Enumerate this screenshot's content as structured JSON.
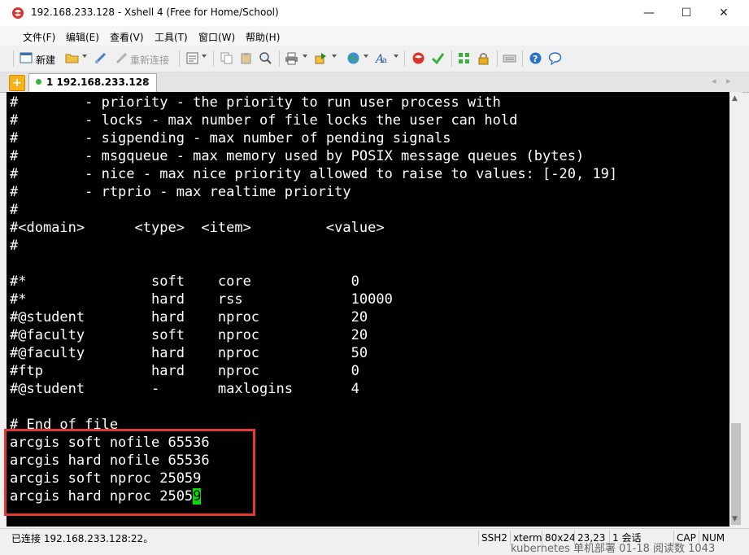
{
  "window": {
    "title": "192.168.233.128 - Xshell 4 (Free for Home/School)",
    "minimize": "—",
    "maximize": "☐",
    "close": "✕"
  },
  "menu": [
    "文件(F)",
    "编辑(E)",
    "查看(V)",
    "工具(T)",
    "窗口(W)",
    "帮助(H)"
  ],
  "toolbar": {
    "new_label": "新建",
    "reconnect_label": "重新连接"
  },
  "tab": {
    "plus": "+",
    "label": "1 192.168.233.128",
    "close": "×",
    "prev": "◂",
    "next": "▸"
  },
  "terminal": {
    "lines": [
      "#        - priority - the priority to run user process with",
      "#        - locks - max number of file locks the user can hold",
      "#        - sigpending - max number of pending signals",
      "#        - msgqueue - max memory used by POSIX message queues (bytes)",
      "#        - nice - max nice priority allowed to raise to values: [-20, 19]",
      "#        - rtprio - max realtime priority",
      "#",
      "#<domain>      <type>  <item>         <value>",
      "#",
      "",
      "#*               soft    core            0",
      "#*               hard    rss             10000",
      "#@student        hard    nproc           20",
      "#@faculty        soft    nproc           20",
      "#@faculty        hard    nproc           50",
      "#ftp             hard    nproc           0",
      "#@student        -       maxlogins       4",
      "",
      "# End of file",
      "arcgis soft nofile 65536",
      "arcgis hard nofile 65536",
      "arcgis soft nproc 25059"
    ],
    "last_line_text": "arcgis hard nproc 2505",
    "cursor_char": "9"
  },
  "status": {
    "connection": "已连接 192.168.233.128:22。",
    "protocol": "SSH2",
    "terminal_type": "xterm",
    "size": "80x24",
    "cursor_pos": "23,23",
    "sessions": "1 会话",
    "caps": "CAP",
    "num": "NUM"
  },
  "background": {
    "overlay_text": "kubernetes 单机部署 01-18  阅读数 1043"
  },
  "colors": {
    "terminal_bg": "#000000",
    "terminal_fg": "#ffffff",
    "cursor": "#00e000",
    "highlight": "#e53935"
  }
}
